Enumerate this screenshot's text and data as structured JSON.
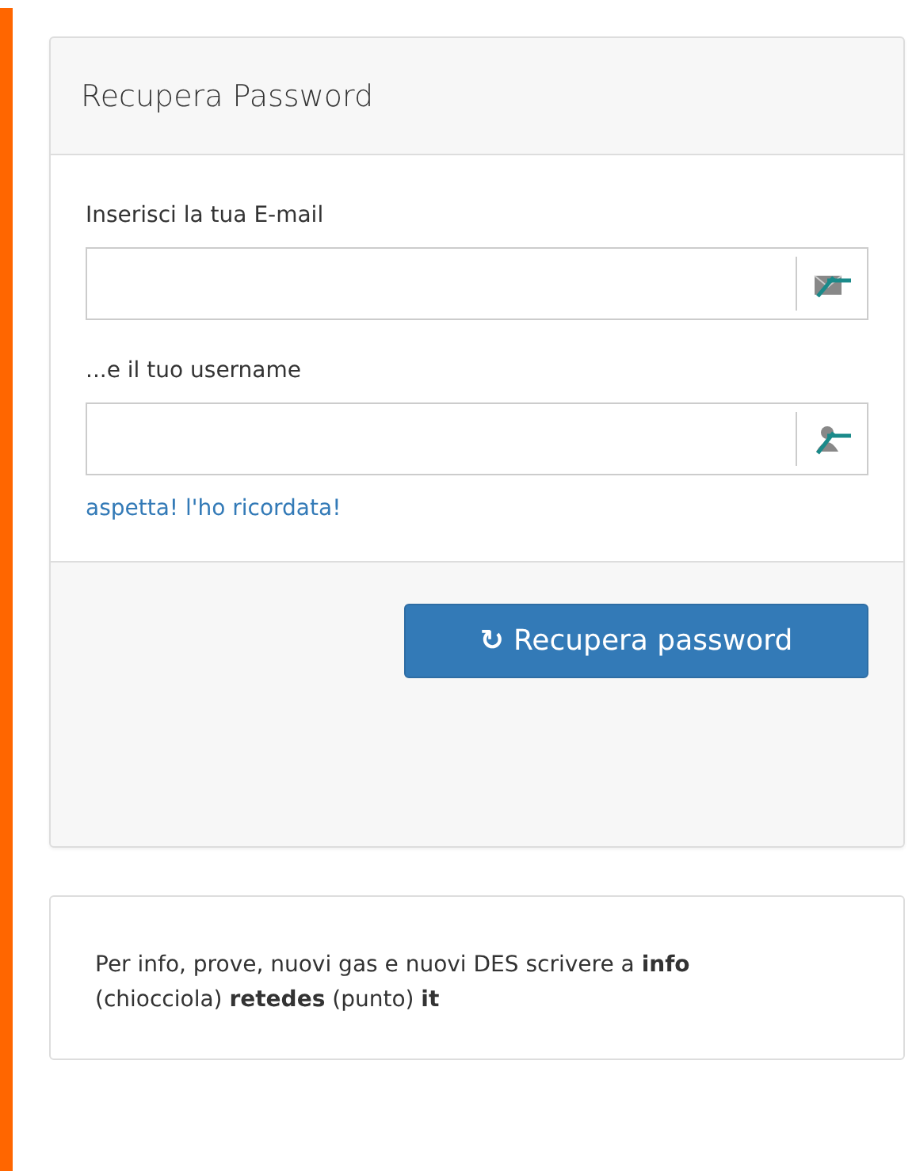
{
  "panel": {
    "title": "Recupera Password",
    "fields": [
      {
        "kind": "email",
        "label": "Inserisci la tua E-mail"
      },
      {
        "kind": "user",
        "label": "...e il tuo username"
      }
    ],
    "link": "aspetta! l'ho ricordata!",
    "button": {
      "icon": "↻",
      "label": "Recupera password"
    }
  },
  "info": {
    "text": "Per info, prove, nuovi gas e nuovi DES scrivere a **info** (chiocciola) **retedes** (punto) **it**"
  }
}
